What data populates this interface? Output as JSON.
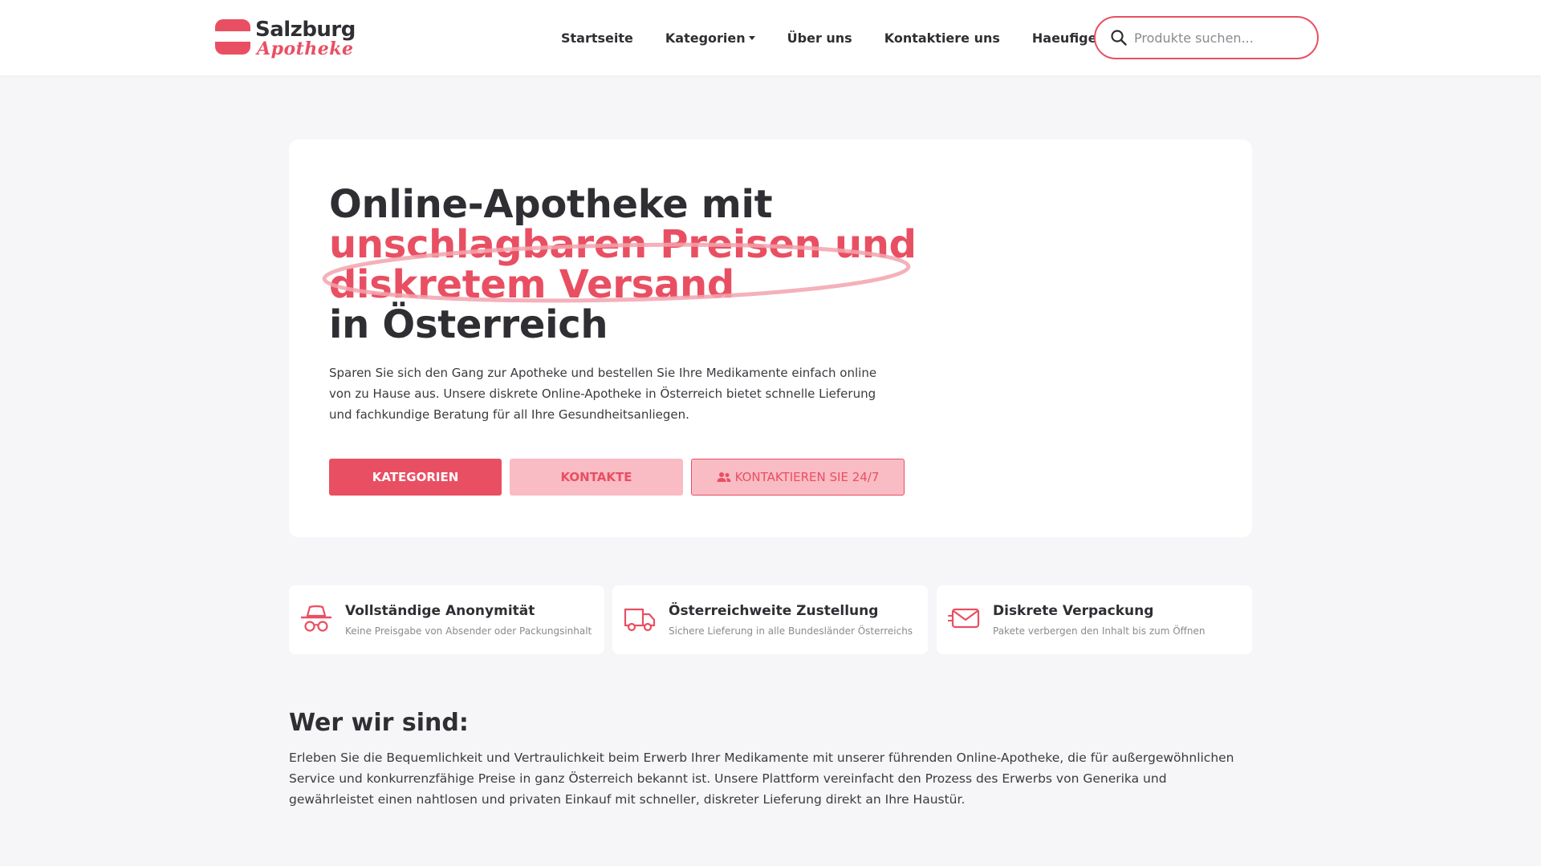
{
  "brand": {
    "name_top": "Salzburg",
    "name_script": "Apotheke",
    "accent_color": "#e94f62",
    "accent_light_color": "#f9bcc4",
    "flag_colors": [
      "#e94f62",
      "#ffffff"
    ]
  },
  "nav": {
    "items": [
      {
        "label": "Startseite"
      },
      {
        "label": "Kategorien",
        "has_dropdown": true
      },
      {
        "label": "Über uns"
      },
      {
        "label": "Kontaktiere uns"
      },
      {
        "label": "Haeufige Fragen"
      }
    ]
  },
  "search": {
    "placeholder": "Produkte suchen...",
    "value": "",
    "icon": "search-icon"
  },
  "hero": {
    "title_line1": "Online-Apotheke mit",
    "title_highlight1": "unschlagbaren Preisen und",
    "title_highlight2": "diskretem Versand",
    "title_line4": "in Österreich",
    "description": "Sparen Sie sich den Gang zur Apotheke und bestellen Sie Ihre Medikamente einfach online von zu Hause aus. Unsere diskrete Online-Apotheke in Österreich bietet schnelle Lieferung und fachkundige Beratung für all Ihre Gesundheitsanliegen.",
    "buttons": {
      "categories": "KATEGORIEN",
      "contacts": "KONTAKTE",
      "contact_247": "KONTAKTIEREN SIE 24/7"
    }
  },
  "features": [
    {
      "title": "Vollständige Anonymität",
      "subtitle": "Keine Preisgabe von Absender oder Packungsinhalt",
      "icon": "incognito-icon"
    },
    {
      "title": "Österreichweite Zustellung",
      "subtitle": "Sichere Lieferung in alle Bundesländer Österreichs",
      "icon": "truck-icon"
    },
    {
      "title": "Diskrete Verpackung",
      "subtitle": "Pakete verbergen den Inhalt bis zum Öffnen",
      "icon": "envelope-icon"
    }
  ],
  "about": {
    "title": "Wer wir sind:",
    "text": "Erleben Sie die Bequemlichkeit und Vertraulichkeit beim Erwerb Ihrer Medikamente mit unserer führenden Online-Apotheke, die für außergewöhnlichen Service und konkurrenzfähige Preise in ganz Österreich bekannt ist. Unsere Plattform vereinfacht den Prozess des Erwerbs von Generika und gewährleistet einen nahtlosen und privaten Einkauf mit schneller, diskreter Lieferung direkt an Ihre Haustür."
  }
}
